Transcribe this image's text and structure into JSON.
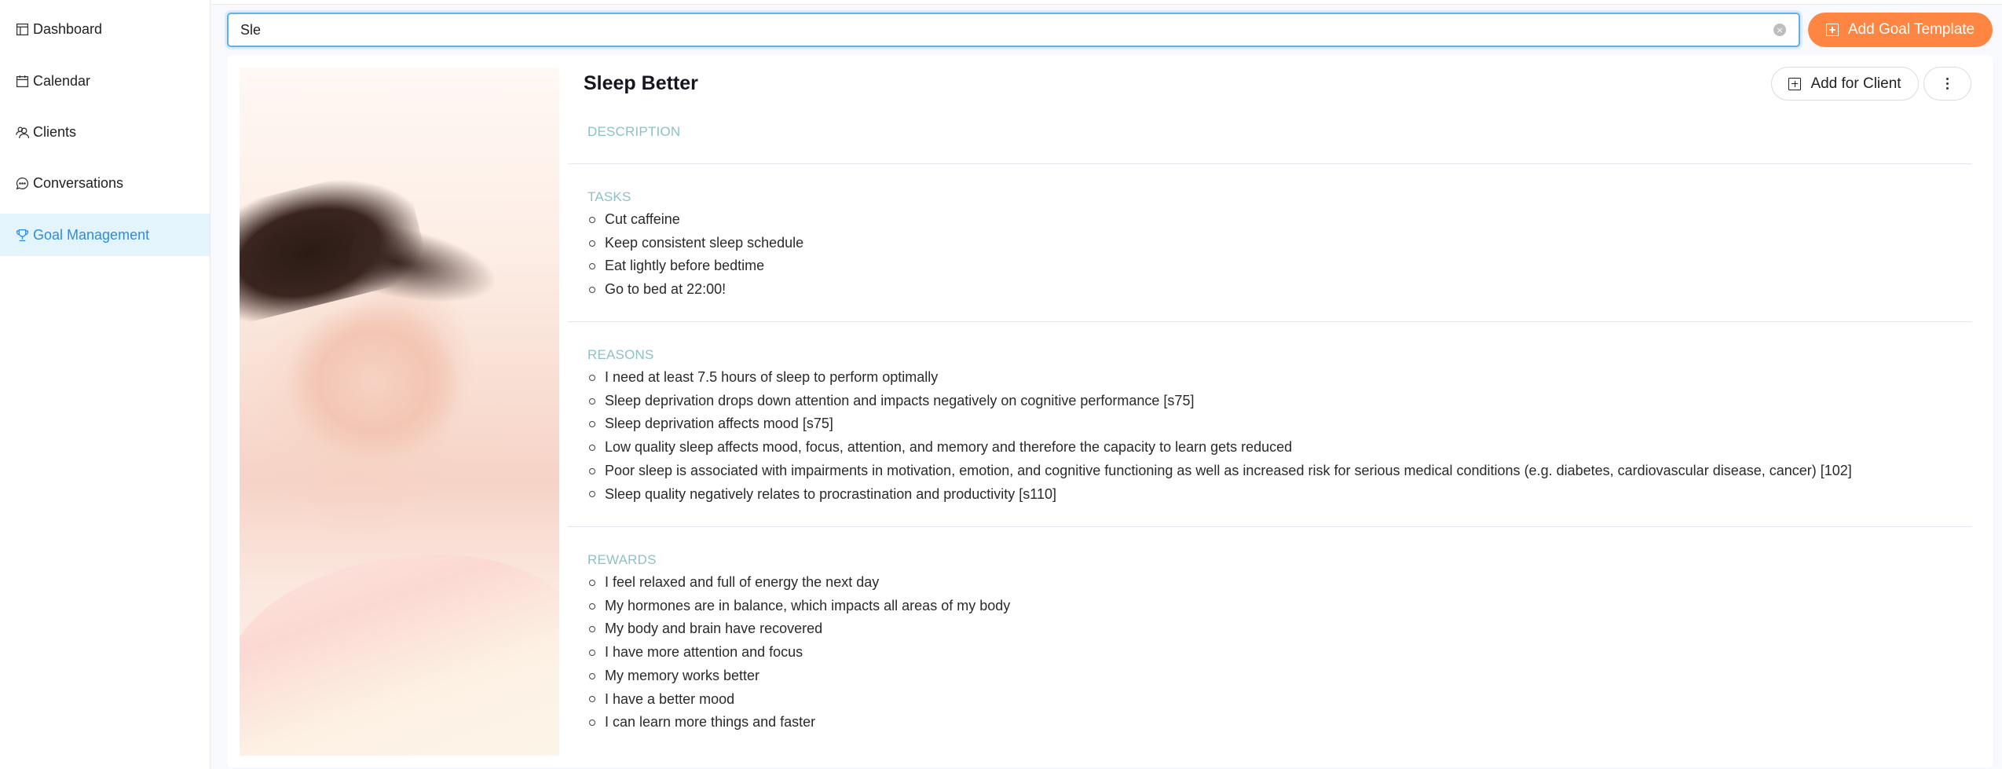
{
  "sidebar": {
    "items": [
      {
        "label": "Dashboard",
        "icon": "dashboard-icon",
        "active": false
      },
      {
        "label": "Calendar",
        "icon": "calendar-icon",
        "active": false
      },
      {
        "label": "Clients",
        "icon": "clients-icon",
        "active": false
      },
      {
        "label": "Conversations",
        "icon": "conversations-icon",
        "active": false
      },
      {
        "label": "Goal Management",
        "icon": "trophy-icon",
        "active": true
      }
    ]
  },
  "search": {
    "value": "Sle",
    "clear_icon": "clear-icon"
  },
  "toolbar": {
    "add_goal_template_label": "Add Goal Template",
    "add_goal_template_icon": "plus-square-icon"
  },
  "goal": {
    "title": "Sleep Better",
    "image_alt": "Woman sleeping peacefully in bed",
    "add_for_client_label": "Add for Client",
    "more_icon": "more-vertical-icon",
    "sections": {
      "description": {
        "label": "DESCRIPTION",
        "items": []
      },
      "tasks": {
        "label": "TASKS",
        "items": [
          "Cut caffeine",
          "Keep consistent sleep schedule",
          "Eat lightly before bedtime",
          "Go to bed at 22:00!"
        ]
      },
      "reasons": {
        "label": "REASONS",
        "items": [
          "I need at least 7.5 hours of sleep to perform optimally",
          "Sleep deprivation drops down attention and impacts negatively on cognitive performance [s75]",
          "Sleep deprivation affects mood [s75]",
          "Low quality sleep affects mood, focus, attention, and memory and therefore the capacity to learn gets reduced",
          "Poor sleep is associated with impairments in motivation, emotion, and cognitive functioning as well as increased risk for serious medical conditions (e.g. diabetes, cardiovascular disease, cancer) [102]",
          "Sleep quality negatively relates to procrastination and productivity [s110]"
        ]
      },
      "rewards": {
        "label": "REWARDS",
        "items": [
          "I feel relaxed and full of energy the next day",
          "My hormones are in balance, which impacts all areas of my body",
          "My body and brain have recovered",
          "I have more attention and focus",
          "My memory works better",
          "I have a better mood",
          "I can learn more things and faster"
        ]
      }
    }
  },
  "colors": {
    "accent": "#ff8642",
    "active_nav_text": "#2a8be8",
    "active_nav_bg": "#e3f4fd",
    "section_label": "#8ec1c7",
    "focus_border": "#62aee9"
  }
}
